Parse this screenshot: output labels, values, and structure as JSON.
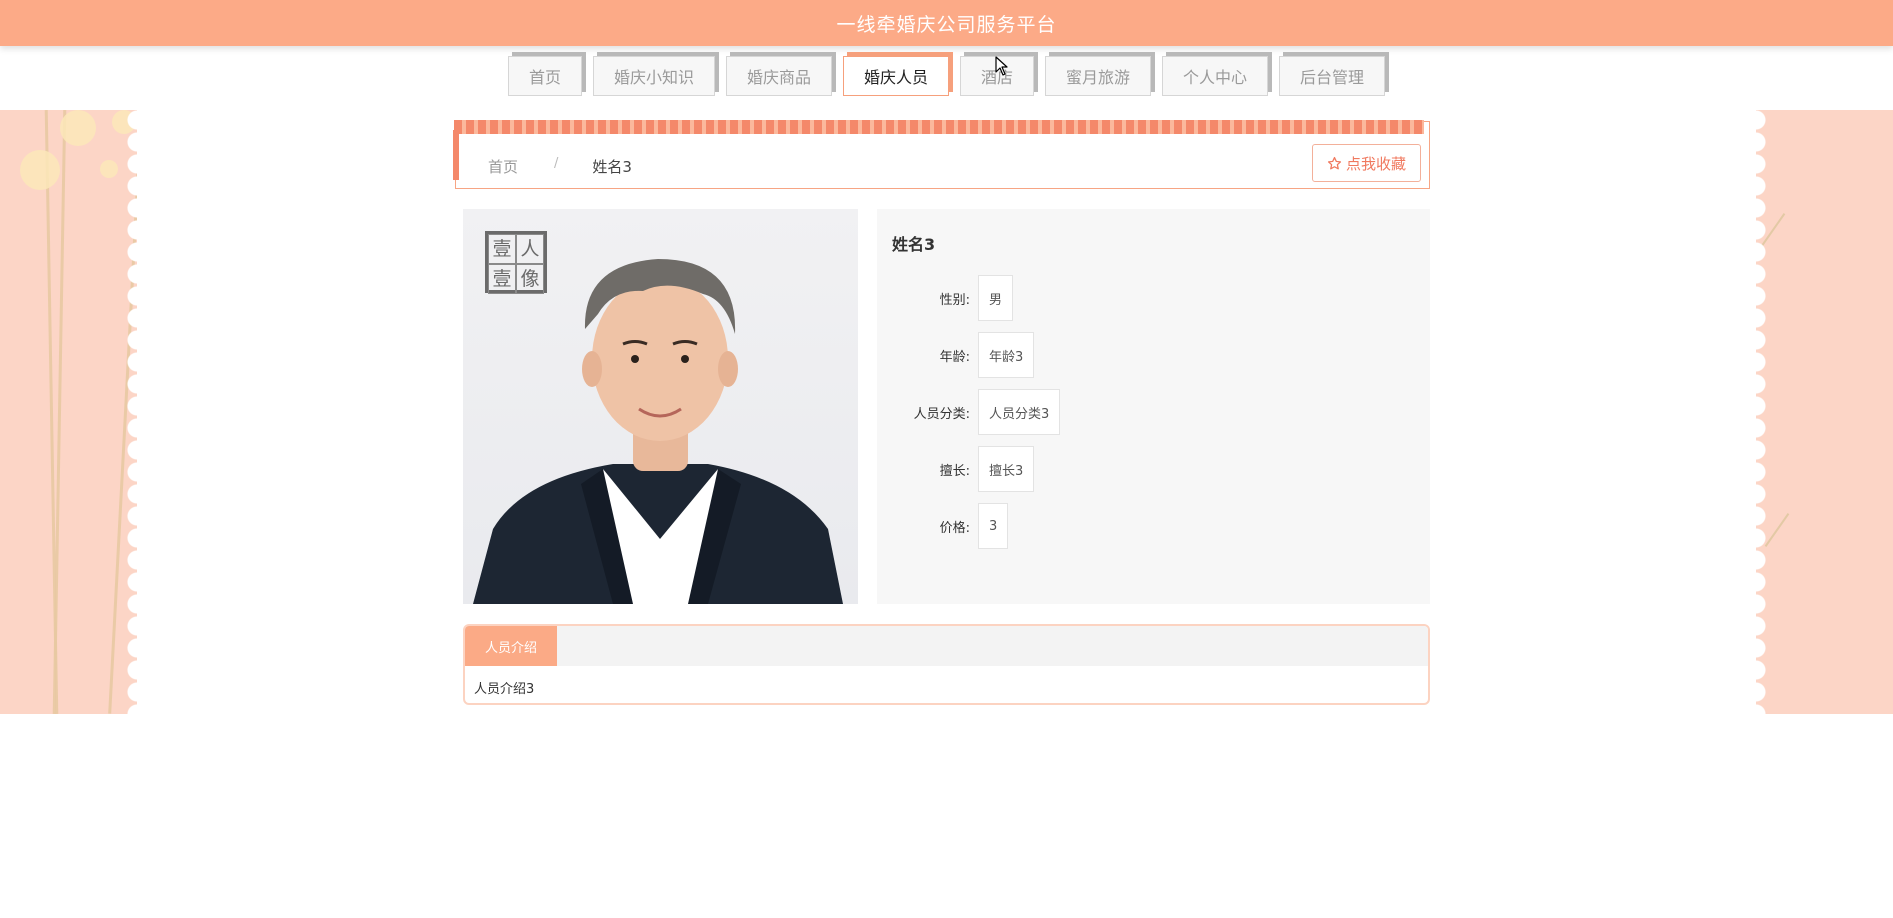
{
  "header": {
    "title": "一线牵婚庆公司服务平台"
  },
  "nav": {
    "items": [
      {
        "label": "首页",
        "active": false
      },
      {
        "label": "婚庆小知识",
        "active": false
      },
      {
        "label": "婚庆商品",
        "active": false
      },
      {
        "label": "婚庆人员",
        "active": true
      },
      {
        "label": "酒店",
        "active": false
      },
      {
        "label": "蜜月旅游",
        "active": false
      },
      {
        "label": "个人中心",
        "active": false
      },
      {
        "label": "后台管理",
        "active": false
      }
    ]
  },
  "breadcrumb": {
    "home": "首页",
    "separator": "/",
    "current": "姓名3"
  },
  "collect_button": {
    "icon": "star-outline-icon",
    "label": "点我收藏"
  },
  "photo": {
    "watermark": [
      "壹",
      "人",
      "壹",
      "像"
    ]
  },
  "detail": {
    "name": "姓名3",
    "fields": [
      {
        "label": "性别:",
        "value": "男"
      },
      {
        "label": "年龄:",
        "value": "年龄3"
      },
      {
        "label": "人员分类:",
        "value": "人员分类3"
      },
      {
        "label": "擅长:",
        "value": "擅长3"
      },
      {
        "label": "价格:",
        "value": "3"
      }
    ]
  },
  "tabs": {
    "active_label": "人员介绍",
    "content": "人员介绍3"
  },
  "colors": {
    "brand": "#fcaa87",
    "accent": "#f4886a",
    "side_bg": "#fcd5c6"
  }
}
